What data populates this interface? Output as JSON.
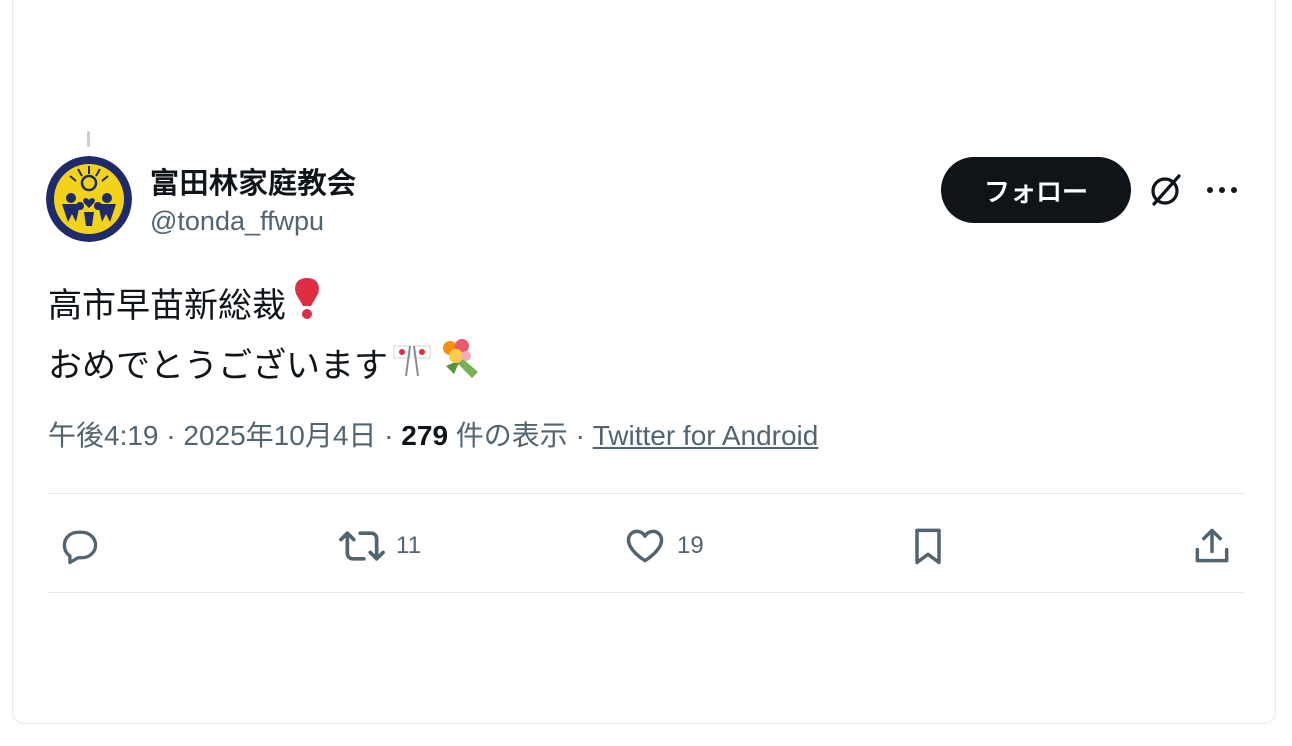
{
  "author": {
    "display_name": "富田林家庭教会",
    "handle": "@tonda_ffwpu",
    "avatar_icon": "family-federation-logo"
  },
  "follow_label": "フォロー",
  "tweet": {
    "line1": "高市早苗新総裁",
    "line2": "おめでとうございます",
    "emojis": [
      "heavy-exclamation-mark-emoji",
      "crossed-flags-emoji",
      "bouquet-emoji"
    ]
  },
  "meta": {
    "time": "午後4:19",
    "sep1": " · ",
    "date": "2025年10月4日",
    "sep2": " · ",
    "views_count": "279",
    "views_label": " 件の表示",
    "sep3": " · ",
    "source": "Twitter for Android"
  },
  "actions": {
    "reply_count": "",
    "retweet_count": "11",
    "like_count": "19",
    "bookmark_count": "",
    "share_count": ""
  },
  "colors": {
    "text_primary": "#0f1419",
    "text_secondary": "#536471",
    "divider": "#e6e9ec",
    "follow_bg": "#0f1419",
    "avatar_navy": "#1f2a6b",
    "avatar_yellow": "#f3d21b"
  }
}
